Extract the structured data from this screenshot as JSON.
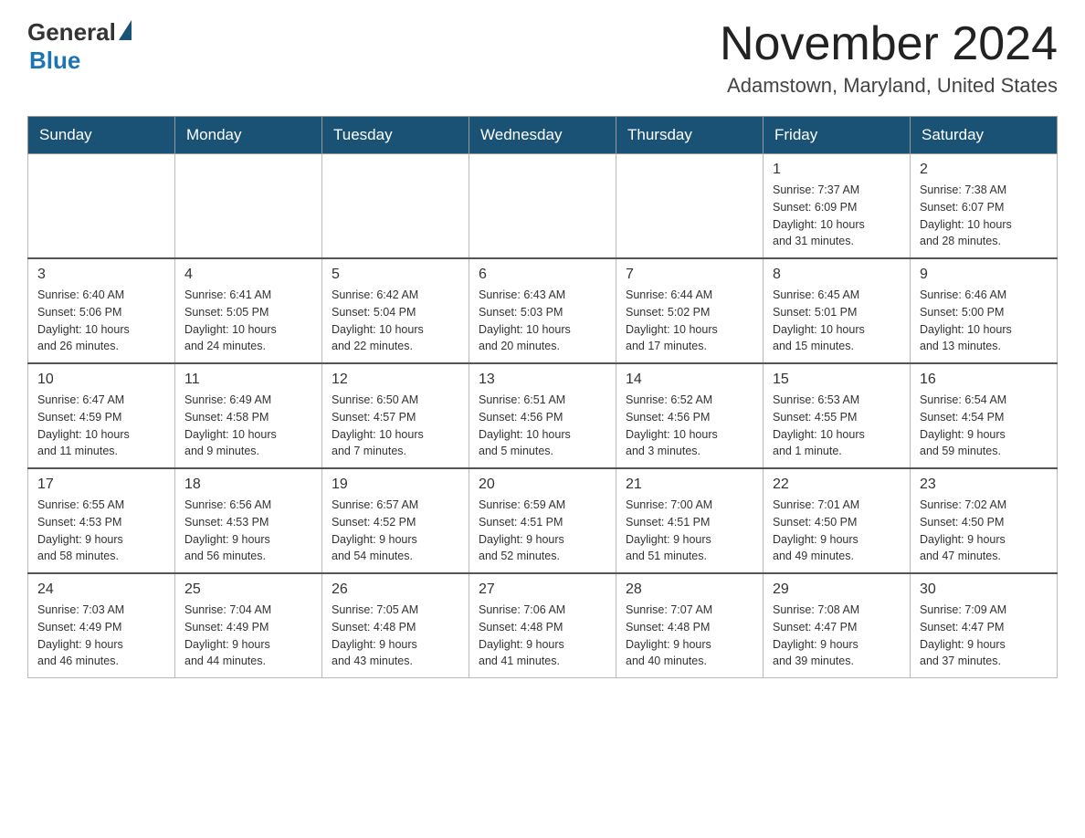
{
  "header": {
    "logo_general": "General",
    "logo_blue": "Blue",
    "month_title": "November 2024",
    "location": "Adamstown, Maryland, United States"
  },
  "weekdays": [
    "Sunday",
    "Monday",
    "Tuesday",
    "Wednesday",
    "Thursday",
    "Friday",
    "Saturday"
  ],
  "weeks": [
    [
      {
        "day": "",
        "info": ""
      },
      {
        "day": "",
        "info": ""
      },
      {
        "day": "",
        "info": ""
      },
      {
        "day": "",
        "info": ""
      },
      {
        "day": "",
        "info": ""
      },
      {
        "day": "1",
        "info": "Sunrise: 7:37 AM\nSunset: 6:09 PM\nDaylight: 10 hours\nand 31 minutes."
      },
      {
        "day": "2",
        "info": "Sunrise: 7:38 AM\nSunset: 6:07 PM\nDaylight: 10 hours\nand 28 minutes."
      }
    ],
    [
      {
        "day": "3",
        "info": "Sunrise: 6:40 AM\nSunset: 5:06 PM\nDaylight: 10 hours\nand 26 minutes."
      },
      {
        "day": "4",
        "info": "Sunrise: 6:41 AM\nSunset: 5:05 PM\nDaylight: 10 hours\nand 24 minutes."
      },
      {
        "day": "5",
        "info": "Sunrise: 6:42 AM\nSunset: 5:04 PM\nDaylight: 10 hours\nand 22 minutes."
      },
      {
        "day": "6",
        "info": "Sunrise: 6:43 AM\nSunset: 5:03 PM\nDaylight: 10 hours\nand 20 minutes."
      },
      {
        "day": "7",
        "info": "Sunrise: 6:44 AM\nSunset: 5:02 PM\nDaylight: 10 hours\nand 17 minutes."
      },
      {
        "day": "8",
        "info": "Sunrise: 6:45 AM\nSunset: 5:01 PM\nDaylight: 10 hours\nand 15 minutes."
      },
      {
        "day": "9",
        "info": "Sunrise: 6:46 AM\nSunset: 5:00 PM\nDaylight: 10 hours\nand 13 minutes."
      }
    ],
    [
      {
        "day": "10",
        "info": "Sunrise: 6:47 AM\nSunset: 4:59 PM\nDaylight: 10 hours\nand 11 minutes."
      },
      {
        "day": "11",
        "info": "Sunrise: 6:49 AM\nSunset: 4:58 PM\nDaylight: 10 hours\nand 9 minutes."
      },
      {
        "day": "12",
        "info": "Sunrise: 6:50 AM\nSunset: 4:57 PM\nDaylight: 10 hours\nand 7 minutes."
      },
      {
        "day": "13",
        "info": "Sunrise: 6:51 AM\nSunset: 4:56 PM\nDaylight: 10 hours\nand 5 minutes."
      },
      {
        "day": "14",
        "info": "Sunrise: 6:52 AM\nSunset: 4:56 PM\nDaylight: 10 hours\nand 3 minutes."
      },
      {
        "day": "15",
        "info": "Sunrise: 6:53 AM\nSunset: 4:55 PM\nDaylight: 10 hours\nand 1 minute."
      },
      {
        "day": "16",
        "info": "Sunrise: 6:54 AM\nSunset: 4:54 PM\nDaylight: 9 hours\nand 59 minutes."
      }
    ],
    [
      {
        "day": "17",
        "info": "Sunrise: 6:55 AM\nSunset: 4:53 PM\nDaylight: 9 hours\nand 58 minutes."
      },
      {
        "day": "18",
        "info": "Sunrise: 6:56 AM\nSunset: 4:53 PM\nDaylight: 9 hours\nand 56 minutes."
      },
      {
        "day": "19",
        "info": "Sunrise: 6:57 AM\nSunset: 4:52 PM\nDaylight: 9 hours\nand 54 minutes."
      },
      {
        "day": "20",
        "info": "Sunrise: 6:59 AM\nSunset: 4:51 PM\nDaylight: 9 hours\nand 52 minutes."
      },
      {
        "day": "21",
        "info": "Sunrise: 7:00 AM\nSunset: 4:51 PM\nDaylight: 9 hours\nand 51 minutes."
      },
      {
        "day": "22",
        "info": "Sunrise: 7:01 AM\nSunset: 4:50 PM\nDaylight: 9 hours\nand 49 minutes."
      },
      {
        "day": "23",
        "info": "Sunrise: 7:02 AM\nSunset: 4:50 PM\nDaylight: 9 hours\nand 47 minutes."
      }
    ],
    [
      {
        "day": "24",
        "info": "Sunrise: 7:03 AM\nSunset: 4:49 PM\nDaylight: 9 hours\nand 46 minutes."
      },
      {
        "day": "25",
        "info": "Sunrise: 7:04 AM\nSunset: 4:49 PM\nDaylight: 9 hours\nand 44 minutes."
      },
      {
        "day": "26",
        "info": "Sunrise: 7:05 AM\nSunset: 4:48 PM\nDaylight: 9 hours\nand 43 minutes."
      },
      {
        "day": "27",
        "info": "Sunrise: 7:06 AM\nSunset: 4:48 PM\nDaylight: 9 hours\nand 41 minutes."
      },
      {
        "day": "28",
        "info": "Sunrise: 7:07 AM\nSunset: 4:48 PM\nDaylight: 9 hours\nand 40 minutes."
      },
      {
        "day": "29",
        "info": "Sunrise: 7:08 AM\nSunset: 4:47 PM\nDaylight: 9 hours\nand 39 minutes."
      },
      {
        "day": "30",
        "info": "Sunrise: 7:09 AM\nSunset: 4:47 PM\nDaylight: 9 hours\nand 37 minutes."
      }
    ]
  ]
}
